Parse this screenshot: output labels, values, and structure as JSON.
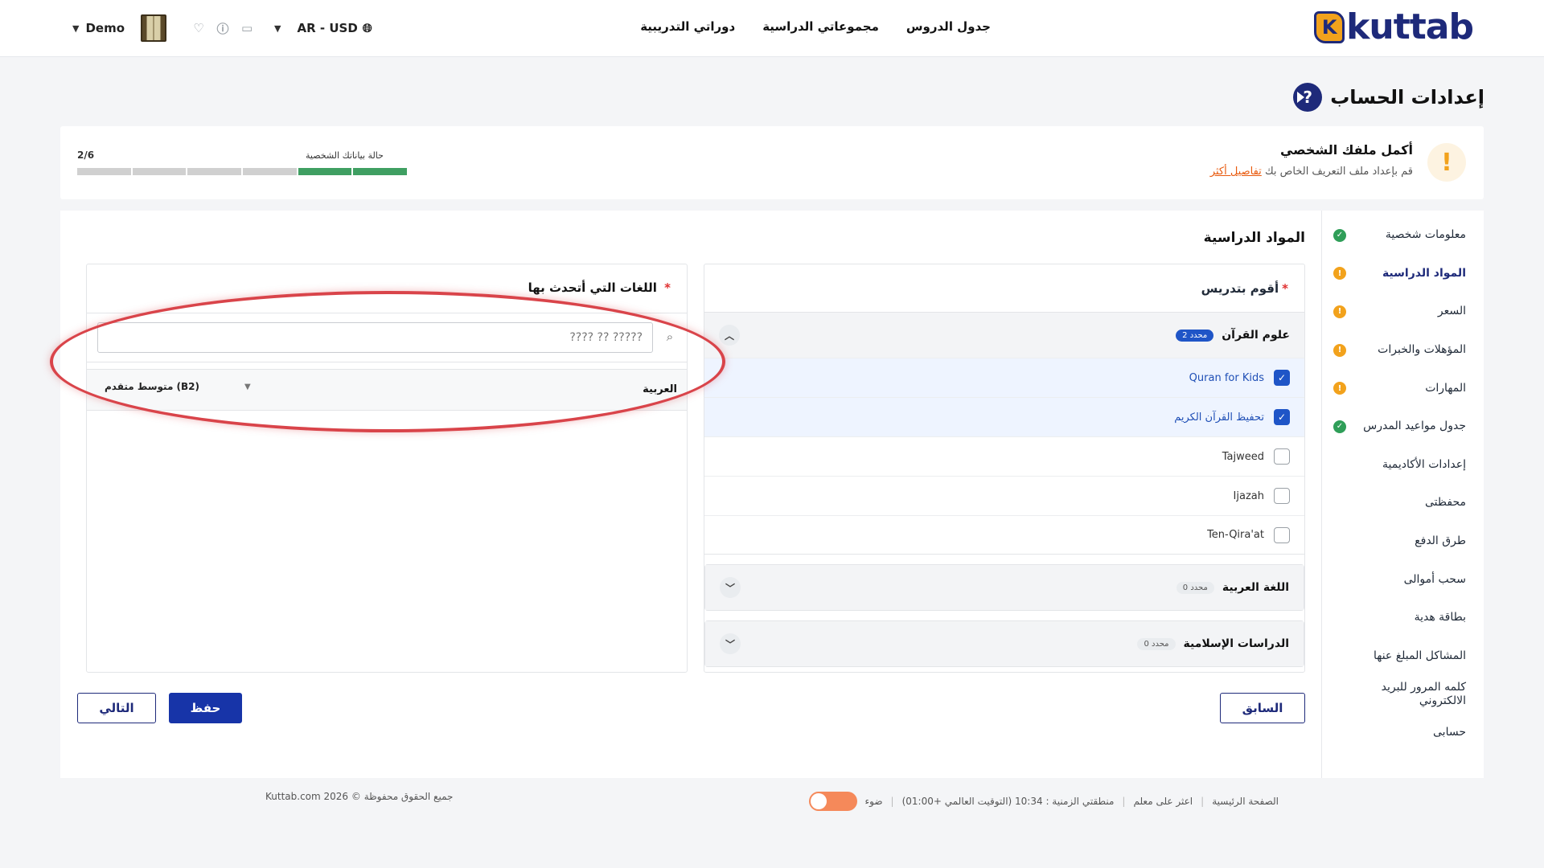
{
  "header": {
    "logo_text": "kuttab",
    "logo_badge": "K",
    "nav": [
      "جدول الدروس",
      "مجموعاتي الدراسية",
      "دوراتي التدريبية"
    ],
    "user_name": "Demo",
    "currency": "AR - USD"
  },
  "page": {
    "title": "إعدادات الحساب"
  },
  "profile": {
    "title": "أكمل ملفك الشخصي",
    "subtitle": "قم بإعداد ملف التعريف الخاص بك",
    "link": "تفاصيل أكثر",
    "status_label": "حالة بياناتك الشخصية",
    "progress_text": "2/6",
    "progress": {
      "done": 2,
      "total": 6
    }
  },
  "sidebar": {
    "items": [
      {
        "label": "معلومات شخصية",
        "status": "ok"
      },
      {
        "label": "المواد الدراسية",
        "status": "warn",
        "active": true
      },
      {
        "label": "السعر",
        "status": "warn"
      },
      {
        "label": "المؤهلات والخبرات",
        "status": "warn"
      },
      {
        "label": "المهارات",
        "status": "warn"
      },
      {
        "label": "جدول مواعيد المدرس",
        "status": "ok"
      },
      {
        "label": "إعدادات الأكاديمية"
      },
      {
        "label": "محفظتى"
      },
      {
        "label": "طرق الدفع"
      },
      {
        "label": "سحب أموالى"
      },
      {
        "label": "بطاقة هدية"
      },
      {
        "label": "المشاكل المبلغ عنها"
      },
      {
        "label": "كلمه المرور للبريد الالكتروني"
      },
      {
        "label": "حسابى"
      }
    ]
  },
  "main": {
    "title": "المواد الدراسية",
    "subjects_title": "أقوم بتدريس",
    "required_mark": "*",
    "groups": [
      {
        "name": "علوم القرآن",
        "badge": "2 محدد",
        "toggle": "^",
        "options": [
          {
            "label": "Quran for Kids",
            "checked": true
          },
          {
            "label": "تحفيظ القرآن الكريم",
            "checked": true
          },
          {
            "label": "Tajweed",
            "checked": false
          },
          {
            "label": "Ijazah",
            "checked": false
          },
          {
            "label": "Ten-Qira'at",
            "checked": false
          }
        ]
      },
      {
        "name": "اللغة العربية",
        "badge": "0 محدد",
        "toggle": "v"
      },
      {
        "name": "الدراسات الإسلامية",
        "badge": "0 محدد",
        "toggle": "v"
      }
    ],
    "languages_title": "اللغات التي أتحدث بها",
    "search_placeholder": "????? ?? ????",
    "language_row": {
      "name": "العربية",
      "level": "متوسط متقدم (B2)"
    }
  },
  "buttons": {
    "previous": "السابق",
    "save": "حفظ",
    "next": "التالي"
  },
  "footer": {
    "home": "الصفحة الرئيسية",
    "find_teacher": "اعثر على معلم",
    "timezone": "منطقتي الزمنية : 10:34 (التوقيت العالمي +01:00)",
    "light": "ضوء",
    "copyright": "Kuttab.com 2026 © جميع الحقوق محفوظة"
  },
  "colors": {
    "brand": "#1e2a7a",
    "accent": "#f2a21c",
    "primary_button": "#1734a8",
    "success": "#2f9e58"
  }
}
